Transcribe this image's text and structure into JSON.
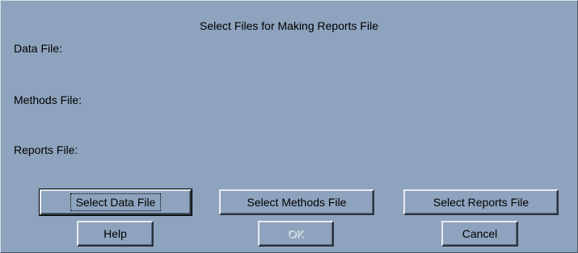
{
  "dialog": {
    "title": "Select Files for Making Reports File",
    "data_file_label": "Data File:",
    "methods_file_label": "Methods File:",
    "reports_file_label": "Reports File:"
  },
  "buttons": {
    "select_data_file": "Select Data File",
    "select_methods_file": "Select Methods File",
    "select_reports_file": "Select Reports File",
    "help": "Help",
    "ok": "OK",
    "cancel": "Cancel"
  },
  "state": {
    "ok_enabled": false,
    "focused_button": "Select Data File"
  }
}
